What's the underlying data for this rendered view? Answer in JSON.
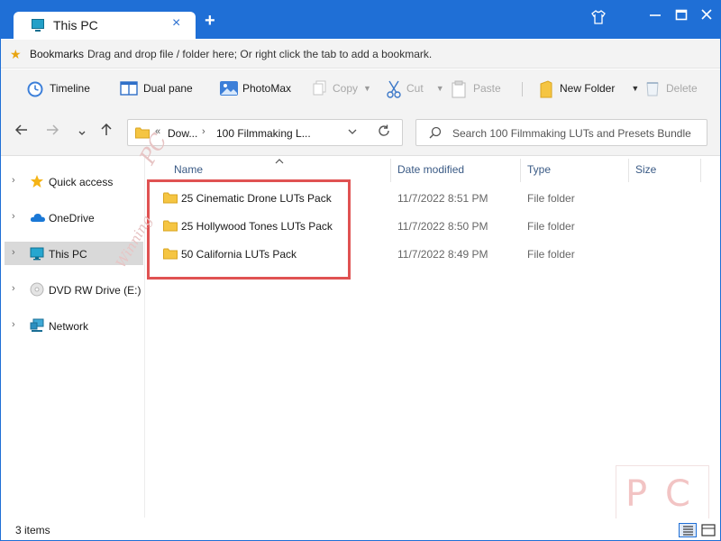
{
  "tab": {
    "title": "This PC",
    "close": "×",
    "new": "+"
  },
  "bookmarks": {
    "label": "Bookmarks",
    "hint": "Drag and drop file / folder here; Or right click the tab to add a bookmark."
  },
  "toolbar": {
    "timeline": "Timeline",
    "dual_pane": "Dual pane",
    "photomax": "PhotoMax",
    "copy": "Copy",
    "cut": "Cut",
    "paste": "Paste",
    "new_folder": "New Folder",
    "delete": "Delete"
  },
  "address": {
    "chevron": "«",
    "crumb1": "Dow...",
    "crumb2": "100 Filmmaking L...",
    "search_placeholder": "Search 100 Filmmaking LUTs and Presets Bundle"
  },
  "nav": {
    "items": [
      {
        "label": "Quick access",
        "icon": "star-icon"
      },
      {
        "label": "OneDrive",
        "icon": "cloud-icon"
      },
      {
        "label": "This PC",
        "icon": "monitor-icon",
        "selected": true
      },
      {
        "label": "DVD RW Drive (E:)",
        "icon": "disc-icon"
      },
      {
        "label": "Network",
        "icon": "network-icon"
      }
    ]
  },
  "columns": {
    "name": "Name",
    "date": "Date modified",
    "type": "Type",
    "size": "Size"
  },
  "files": [
    {
      "name": "25 Cinematic Drone LUTs Pack",
      "date": "11/7/2022 8:51 PM",
      "type": "File folder"
    },
    {
      "name": "25 Hollywood Tones LUTs Pack",
      "date": "11/7/2022 8:50 PM",
      "type": "File folder"
    },
    {
      "name": "50 California LUTs Pack",
      "date": "11/7/2022 8:49 PM",
      "type": "File folder"
    }
  ],
  "status": {
    "count": "3 items"
  },
  "watermark": {
    "line1": "Winning",
    "line2": "PC",
    "logo_p": "P",
    "logo_c": "C"
  },
  "colors": {
    "accent": "#1f6fd6",
    "highlight": "#e05252",
    "folder": "#f5c542"
  }
}
